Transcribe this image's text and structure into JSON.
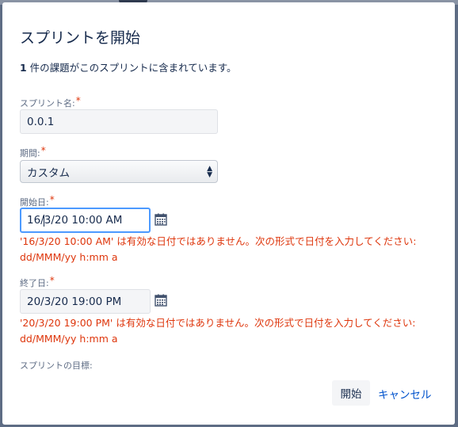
{
  "dialog": {
    "title": "スプリントを開始",
    "issue_count": "1",
    "issue_count_suffix": " 件の課題がこのスプリントに含まれています。"
  },
  "fields": {
    "sprint_name": {
      "label": "スプリント名:",
      "required": "*",
      "value": "0.0.1"
    },
    "duration": {
      "label": "期間:",
      "required": "*",
      "value": "カスタム"
    },
    "start_date": {
      "label": "開始日:",
      "required": "*",
      "value_before_cursor": "16/",
      "value_after_cursor": "3/20 10:00 AM",
      "error": "'16/3/20 10:00 AM' は有効な日付ではありません。次の形式で日付を入力してください: dd/MMM/yy h:mm a"
    },
    "end_date": {
      "label": "終了日:",
      "required": "*",
      "value": "20/3/20 19:00 PM",
      "error": "'20/3/20 19:00 PM' は有効な日付ではありません。次の形式で日付を入力してください: dd/MMM/yy h:mm a"
    },
    "sprint_goal": {
      "label": "スプリントの目標:"
    }
  },
  "buttons": {
    "start": "開始",
    "cancel": "キャンセル"
  },
  "icons": {
    "calendar": "calendar-icon",
    "select_arrows": "updown-arrow-icon"
  },
  "colors": {
    "error": "#de350b",
    "link": "#0052cc",
    "focus": "#4c9aff",
    "text": "#172b4d"
  }
}
